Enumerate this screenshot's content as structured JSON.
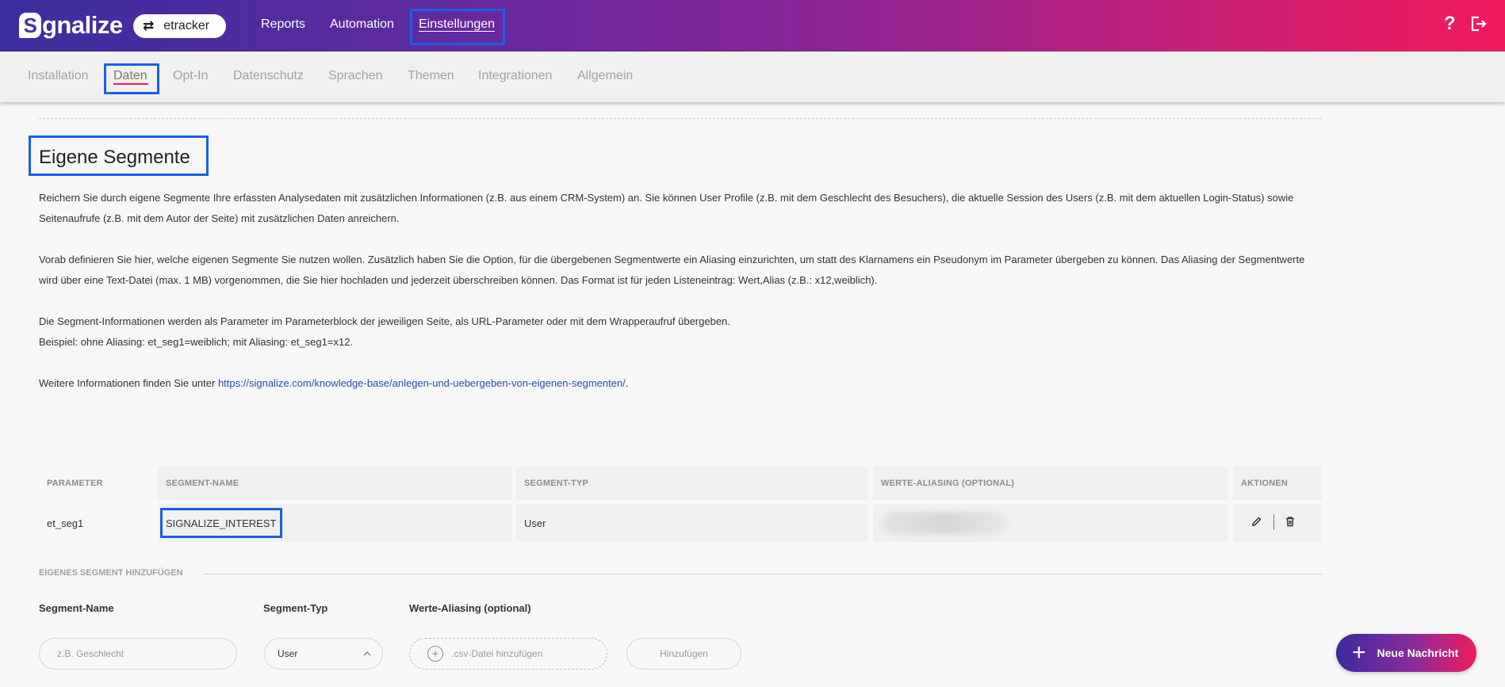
{
  "app": {
    "logo_text": "gnalize",
    "logo_mark": "S"
  },
  "account": {
    "name": "etracker",
    "icon": "swap-arrows-icon"
  },
  "nav": {
    "reports": "Reports",
    "automation": "Automation",
    "settings": "Einstellungen"
  },
  "header_icons": {
    "help": "?",
    "logout": "logout-icon"
  },
  "subnav": {
    "tabs": [
      "Installation",
      "Daten",
      "Opt-In",
      "Datenschutz",
      "Sprachen",
      "Themen",
      "Integrationen",
      "Allgemein"
    ],
    "active": "Daten"
  },
  "page": {
    "title": "Eigene Segmente",
    "p1": "Reichern Sie durch eigene Segmente Ihre erfassten Analysedaten mit zusätzlichen Informationen (z.B. aus einem CRM-System) an. Sie können User Profile (z.B. mit dem Geschlecht des Besuchers), die aktuelle Session des Users (z.B. mit dem aktuellen Login-Status) sowie Seitenaufrufe (z.B. mit dem Autor der Seite) mit zusätzlichen Daten anreichern.",
    "p2": "Vorab definieren Sie hier, welche eigenen Segmente Sie nutzen wollen. Zusätzlich haben Sie die Option, für die übergebenen Segmentwerte ein Aliasing einzurichten, um statt des Klarnamens ein Pseudonym im Parameter übergeben zu können. Das Aliasing der Segmentwerte wird über eine Text-Datei (max. 1 MB) vorgenommen, die Sie hier hochladen und jederzeit überschreiben können. Das Format ist für jeden Listeneintrag: Wert,Alias (z.B.: x12,weiblich).",
    "p3a": "Die Segment-Informationen werden als Parameter im Parameterblock der jeweiligen Seite, als URL-Parameter oder mit dem Wrapperaufruf übergeben.",
    "p3b": "Beispiel: ohne Aliasing: et_seg1=weiblich; mit Aliasing: et_seg1=x12.",
    "p4_prefix": "Weitere Informationen finden Sie unter ",
    "p4_link": "https://signalize.com/knowledge-base/anlegen-und-uebergeben-von-eigenen-segmenten/",
    "p4_suffix": "."
  },
  "table": {
    "headers": [
      "PARAMETER",
      "SEGMENT-NAME",
      "SEGMENT-TYP",
      "WERTE-ALIASING (OPTIONAL)",
      "AKTIONEN"
    ],
    "rows": [
      {
        "parameter": "et_seg1",
        "segment_name": "SIGNALIZE_INTEREST",
        "segment_type": "User",
        "aliasing": ""
      }
    ]
  },
  "add_segment": {
    "heading": "EIGENES SEGMENT HINZUFÜGEN",
    "name_label": "Segment-Name",
    "name_placeholder": "z.B. Geschlecht",
    "type_label": "Segment-Typ",
    "type_value": "User",
    "aliasing_label": "Werte-Aliasing (optional)",
    "upload_label": ".csv-Datei hinzufügen",
    "add_button": "Hinzufügen"
  },
  "fab": {
    "label": "Neue Nachricht"
  },
  "colors": {
    "accent": "#e8204f",
    "highlight_box": "#1a5fe6",
    "link": "#2a4fb6",
    "gradient_start": "#3a2e9e",
    "gradient_end": "#f31a5c"
  }
}
